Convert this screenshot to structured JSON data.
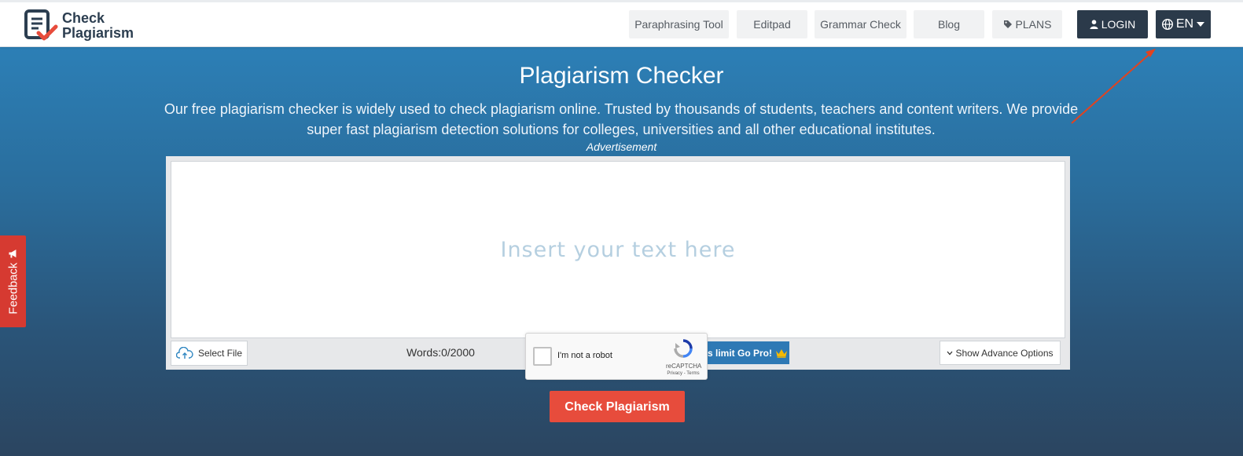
{
  "header": {
    "logo": {
      "line1": "Check",
      "line2": "Plagiarism"
    },
    "nav": [
      {
        "label": "Paraphrasing Tool"
      },
      {
        "label": "Editpad"
      },
      {
        "label": "Grammar Check"
      },
      {
        "label": "Blog"
      },
      {
        "label": "PLANS",
        "icon": "tag-icon"
      }
    ],
    "login": {
      "label": "LOGIN",
      "icon": "user-icon"
    },
    "language": {
      "label": "EN",
      "icon": "globe-icon"
    }
  },
  "hero": {
    "title": "Plagiarism Checker",
    "subtitle": "Our free plagiarism checker is widely used to check plagiarism online. Trusted by thousands of students, teachers and content writers. We provide super fast plagiarism detection solutions for colleges, universities and all other educational institutes.",
    "advertisement": "Advertisement"
  },
  "editor": {
    "placeholder": "Insert your text here",
    "select_file": "Select File",
    "words": "Words:0/2000",
    "go_pro": "Up to 20k words limit Go Pro!",
    "advance_options": "Show Advance Options"
  },
  "captcha": {
    "label": "I'm not a robot",
    "brand": "reCAPTCHA",
    "links": "Privacy - Terms"
  },
  "check_button": "Check Plagiarism",
  "feedback": "Feedback",
  "colors": {
    "brand_dark": "#2b3a4a",
    "hero_top": "#2c7fb6",
    "hero_bottom": "#2b4560",
    "accent_red": "#e74c3c",
    "go_pro_blue": "#2e79b5"
  }
}
